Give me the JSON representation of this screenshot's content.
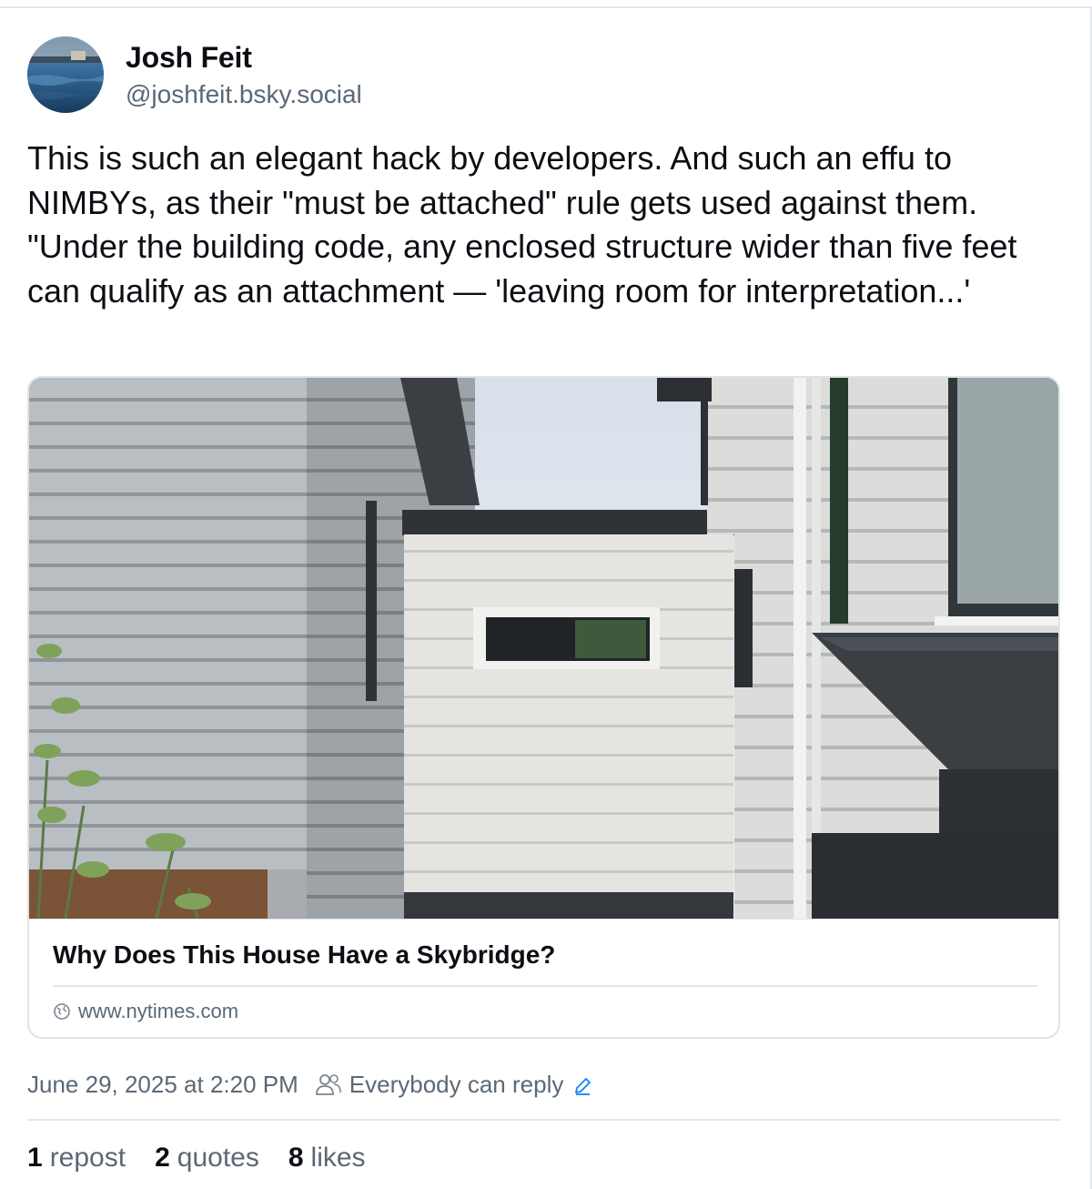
{
  "author": {
    "display_name": "Josh Feit",
    "handle": "@joshfeit.bsky.social",
    "avatar_icon": "avatar-image"
  },
  "post": {
    "text": "This is such an elegant hack by developers. And such an effu to NIMBYs, as their \"must be attached\" rule gets used against them. \"Under the building code, any enclosed structure wider than five feet can qualify as an attachment — 'leaving room for interpretation...'"
  },
  "embed": {
    "title": "Why Does This House Have a Skybridge?",
    "domain": "www.nytimes.com",
    "image_icon": "house-photo"
  },
  "meta": {
    "timestamp": "June 29, 2025 at 2:20 PM",
    "reply_setting": "Everybody can reply"
  },
  "stats": {
    "reposts": {
      "count": "1",
      "label": "repost"
    },
    "quotes": {
      "count": "2",
      "label": "quotes"
    },
    "likes": {
      "count": "8",
      "label": "likes"
    }
  },
  "colors": {
    "text": "#0b0f14",
    "muted": "#5b6875",
    "border": "#dfe3e8",
    "accent": "#1083fe"
  }
}
